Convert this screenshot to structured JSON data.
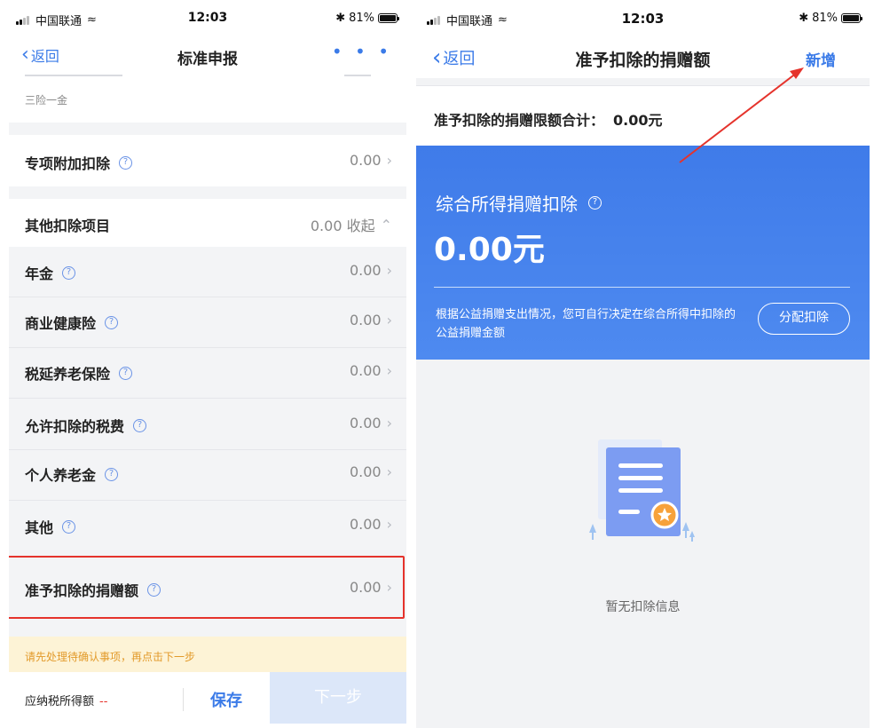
{
  "status_left": {
    "carrier": "中国联通",
    "time": "12:03",
    "battery": "81%"
  },
  "status_right": {
    "carrier": "中国联通",
    "time": "12:03",
    "battery": "81%"
  },
  "left": {
    "nav": {
      "back": "返回",
      "title": "标准申报",
      "more": "• • •"
    },
    "partial_sub": "三险一金",
    "special": {
      "label": "专项附加扣除",
      "value": "0.00"
    },
    "other_header": {
      "label": "其他扣除项目",
      "value": "0.00 收起"
    },
    "items": [
      {
        "label": "年金",
        "value": "0.00"
      },
      {
        "label": "商业健康险",
        "value": "0.00"
      },
      {
        "label": "税延养老保险",
        "value": "0.00"
      },
      {
        "label": "允许扣除的税费",
        "value": "0.00"
      },
      {
        "label": "个人养老金",
        "value": "0.00"
      },
      {
        "label": "其他",
        "value": "0.00"
      },
      {
        "label": "准予扣除的捐赠额",
        "value": "0.00"
      }
    ],
    "notice": "请先处理待确认事项，再点击下一步",
    "bottom": {
      "tax_label": "应纳税所得额",
      "tax_value": "--",
      "save": "保存",
      "next": "下一步"
    }
  },
  "right": {
    "nav": {
      "back": "返回",
      "title": "准予扣除的捐赠额",
      "add": "新增"
    },
    "limit": {
      "label": "准予扣除的捐赠限额合计：",
      "value": "0.00元"
    },
    "card": {
      "heading": "综合所得捐赠扣除",
      "amount": "0.00元",
      "desc": "根据公益捐赠支出情况，您可自行决定在综合所得中扣除的公益捐赠金额",
      "button": "分配扣除"
    },
    "empty": "暂无扣除信息"
  },
  "colors": {
    "accent": "#3b7be8",
    "highlight": "#e5332c",
    "notice_bg": "#fdf3d6",
    "notice_text": "#e29a2a",
    "card": "#4281ec"
  },
  "icons": [
    "signal-icon",
    "wifi-icon",
    "bluetooth-icon",
    "battery-icon",
    "chevron-left-icon",
    "help-icon",
    "chevron-right-icon",
    "chevron-up-icon",
    "document-star-icon"
  ]
}
